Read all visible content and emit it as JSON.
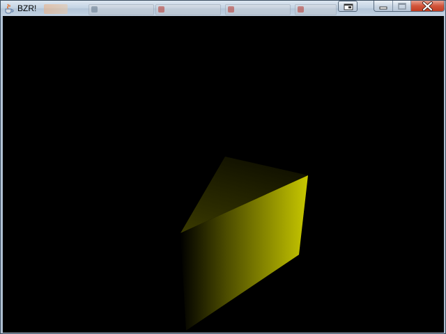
{
  "window": {
    "title": "BZR!",
    "app_icon": "java-cup-icon",
    "caption_buttons": [
      "minimize-icon",
      "maximize-icon",
      "close-icon"
    ],
    "extra_button_icon": "switch-window-icon"
  },
  "scene": {
    "background_color": "#000000",
    "object": "triangular-prism",
    "object_color": "#c8c800",
    "shadow_color": "#000000"
  }
}
